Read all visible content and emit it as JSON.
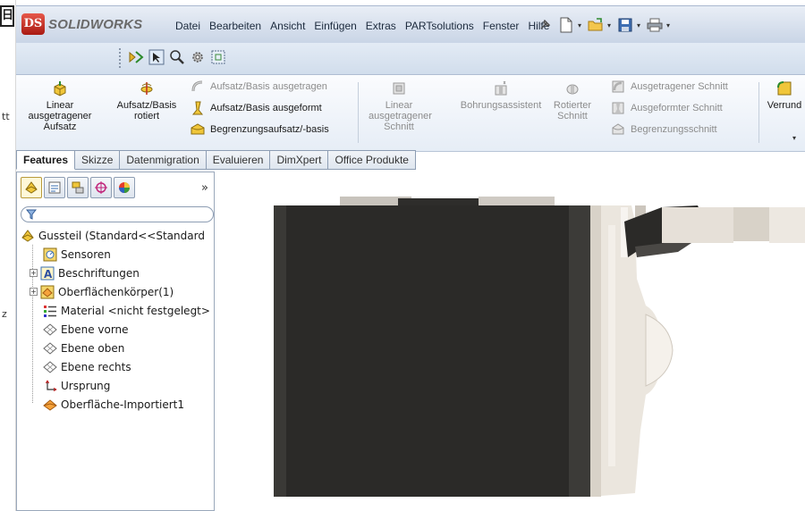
{
  "background_window": {
    "fragments": [
      "tt",
      "z"
    ]
  },
  "app": {
    "name": "SOLIDWORKS",
    "menu": [
      "Datei",
      "Bearbeiten",
      "Ansicht",
      "Einfügen",
      "Extras",
      "PARTsolutions",
      "Fenster",
      "Hilfe"
    ]
  },
  "ribbon": {
    "linear_boss": "Linear ausgetragener Aufsatz",
    "revolved_boss": "Aufsatz/Basis rotiert",
    "swept_boss": "Aufsatz/Basis ausgetragen",
    "lofted_boss": "Aufsatz/Basis ausgeformt",
    "boundary_boss": "Begrenzungsaufsatz/-basis",
    "linear_cut": "Linear ausgetragener Schnitt",
    "hole_wizard": "Bohrungsassistent",
    "revolved_cut": "Rotierter Schnitt",
    "swept_cut": "Ausgetragener Schnitt",
    "lofted_cut": "Ausgeformter Schnitt",
    "boundary_cut": "Begrenzungsschnitt",
    "fillet": "Verrund"
  },
  "tabs": [
    "Features",
    "Skizze",
    "Datenmigration",
    "Evaluieren",
    "DimXpert",
    "Office Produkte"
  ],
  "active_tab": "Features",
  "feature_tree": {
    "root": "Gussteil  (Standard<<Standard",
    "items": [
      {
        "label": "Sensoren",
        "icon": "sensor-icon",
        "expandable": false
      },
      {
        "label": "Beschriftungen",
        "icon": "annotation-icon",
        "expandable": true
      },
      {
        "label": "Oberflächenkörper(1)",
        "icon": "surface-bodies-icon",
        "expandable": true
      },
      {
        "label": "Material <nicht festgelegt>",
        "icon": "material-icon",
        "expandable": false
      },
      {
        "label": "Ebene vorne",
        "icon": "plane-icon",
        "expandable": false
      },
      {
        "label": "Ebene oben",
        "icon": "plane-icon",
        "expandable": false
      },
      {
        "label": "Ebene rechts",
        "icon": "plane-icon",
        "expandable": false
      },
      {
        "label": "Ursprung",
        "icon": "origin-icon",
        "expandable": false
      },
      {
        "label": "Oberfläche-Importiert1",
        "icon": "imported-surface-icon",
        "expandable": false
      }
    ]
  },
  "colors": {
    "titlebar": "#c9d5e6",
    "model_dark": "#2b2a28",
    "model_light": "#e8e3db"
  }
}
